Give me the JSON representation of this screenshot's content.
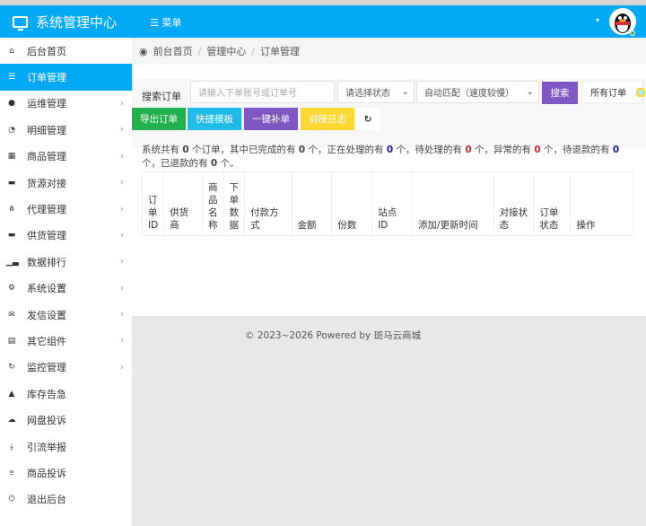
{
  "header": {
    "title": "系统管理中心",
    "menu_label": "菜单",
    "caret": "▾"
  },
  "colors": {
    "primary": "#03a9f4",
    "green": "#23b14d",
    "cyan": "#1ebbe8",
    "purple": "#7e57c2",
    "yellow": "#fdd835"
  },
  "sidebar": {
    "items": [
      {
        "label": "后台首页",
        "icon": "home-icon",
        "glyph": "⌂",
        "chev": ""
      },
      {
        "label": "订单管理",
        "icon": "list-icon",
        "glyph": "☰",
        "chev": "",
        "active": true
      },
      {
        "label": "运维管理",
        "icon": "comments-icon",
        "glyph": "●",
        "chev": "›"
      },
      {
        "label": "明细管理",
        "icon": "pie-chart-icon",
        "glyph": "◔",
        "chev": "›"
      },
      {
        "label": "商品管理",
        "icon": "grid-icon",
        "glyph": "▦",
        "chev": "›"
      },
      {
        "label": "货源对接",
        "icon": "briefcase-icon",
        "glyph": "▬",
        "chev": "›"
      },
      {
        "label": "代理管理",
        "icon": "sitemap-icon",
        "glyph": "⋔",
        "chev": "›"
      },
      {
        "label": "供货管理",
        "icon": "suitcase-icon",
        "glyph": "▬",
        "chev": "›"
      },
      {
        "label": "数据排行",
        "icon": "signal-icon",
        "glyph": "▁▃",
        "chev": "›"
      },
      {
        "label": "系统设置",
        "icon": "cogs-icon",
        "glyph": "⚙",
        "chev": "›"
      },
      {
        "label": "发信设置",
        "icon": "envelope-icon",
        "glyph": "✉",
        "chev": "›"
      },
      {
        "label": "其它组件",
        "icon": "calendar-icon",
        "glyph": "▤",
        "chev": "›"
      },
      {
        "label": "监控管理",
        "icon": "refresh-icon",
        "glyph": "↻",
        "chev": "›"
      },
      {
        "label": "库存告急",
        "icon": "bell-icon",
        "glyph": "▲",
        "chev": ""
      },
      {
        "label": "网盘投诉",
        "icon": "cloud-download-icon",
        "glyph": "☁",
        "chev": ""
      },
      {
        "label": "引流举报",
        "icon": "download-icon",
        "glyph": "⤓",
        "chev": ""
      },
      {
        "label": "商品投诉",
        "icon": "bank-icon",
        "glyph": "⩸",
        "chev": ""
      },
      {
        "label": "退出后台",
        "icon": "power-icon",
        "glyph": "⏻",
        "chev": ""
      }
    ]
  },
  "breadcrumb": {
    "items": [
      "前台首页",
      "管理中心",
      "订单管理"
    ],
    "sep": "/"
  },
  "search": {
    "label": "搜索订单",
    "placeholder": "请输入下单账号或订单号",
    "status_select": "请选择状态",
    "match_select": "自动匹配（速度较慢）",
    "search_btn": "搜索",
    "all_orders": "所有订单"
  },
  "actions": {
    "export": "导出订单",
    "template": "快捷模板",
    "supplement": "一键补单",
    "log": "对接日志",
    "refresh": "↻"
  },
  "summary": {
    "t1": "系统共有 ",
    "total": "0",
    "t2": " 个订单，其中已完成的有 ",
    "done": "0",
    "t3": " 个，正在处理的有 ",
    "processing": "0",
    "t4": " 个，待处理的有 ",
    "pending": "0",
    "t5": " 个，异常的有 ",
    "abnormal": "0",
    "t6": " 个，待退款的有 ",
    "refunding": "0",
    "t7": " 个，已退款的有 ",
    "refunded": "0",
    "t8": " 个。"
  },
  "table": {
    "headers": [
      "订单ID",
      "供货商",
      "商品名称",
      "下单数据",
      "付款方式",
      "金额",
      "份数",
      "站点ID",
      "添加/更新时间",
      "对接状态",
      "订单状态",
      "操作"
    ]
  },
  "footer": {
    "text": "© 2023~2026 Powered by 斑马云商城"
  }
}
